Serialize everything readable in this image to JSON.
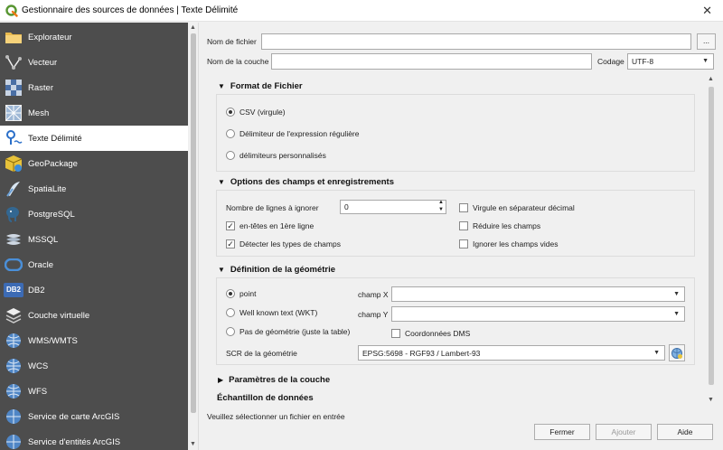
{
  "window": {
    "title": "Gestionnaire des sources de données | Texte Délimité",
    "close_glyph": "✕"
  },
  "sidebar": {
    "items": [
      {
        "label": "Explorateur",
        "icon": "folder-icon"
      },
      {
        "label": "Vecteur",
        "icon": "vector-icon"
      },
      {
        "label": "Raster",
        "icon": "raster-icon"
      },
      {
        "label": "Mesh",
        "icon": "mesh-icon"
      },
      {
        "label": "Texte Délimité",
        "icon": "delimited-text-icon"
      },
      {
        "label": "GeoPackage",
        "icon": "geopackage-icon"
      },
      {
        "label": "SpatiaLite",
        "icon": "spatialite-icon"
      },
      {
        "label": "PostgreSQL",
        "icon": "postgresql-icon"
      },
      {
        "label": "MSSQL",
        "icon": "mssql-icon"
      },
      {
        "label": "Oracle",
        "icon": "oracle-icon"
      },
      {
        "label": "DB2",
        "icon": "db2-icon"
      },
      {
        "label": "Couche virtuelle",
        "icon": "virtual-layer-icon"
      },
      {
        "label": "WMS/WMTS",
        "icon": "wms-icon"
      },
      {
        "label": "WCS",
        "icon": "wcs-icon"
      },
      {
        "label": "WFS",
        "icon": "wfs-icon"
      },
      {
        "label": "Service de carte ArcGIS",
        "icon": "arcgis-map-icon"
      },
      {
        "label": "Service d'entités ArcGIS",
        "icon": "arcgis-feature-icon"
      }
    ],
    "active_index": 4,
    "db2_badge": "DB2"
  },
  "form": {
    "filename_label": "Nom de fichier",
    "filename_value": "",
    "browse_label": "...",
    "layername_label": "Nom de la couche",
    "layername_value": "",
    "encoding_label": "Codage",
    "encoding_value": "UTF-8"
  },
  "file_format": {
    "title": "Format de Fichier",
    "options": [
      "CSV (virgule)",
      "Délimiteur de l'expression régulière",
      "délimiteurs personnalisés"
    ],
    "selected": 0
  },
  "fields_options": {
    "title": "Options des champs et enregistrements",
    "skip_lines_label": "Nombre de lignes à ignorer",
    "skip_lines_value": "0",
    "header_label": "en-têtes en 1ère ligne",
    "header_checked": true,
    "detect_types_label": "Détecter les types de champs",
    "detect_types_checked": true,
    "decimal_comma_label": "Virgule en séparateur décimal",
    "trim_label": "Réduire les champs",
    "discard_empty_label": "Ignorer les champs vides"
  },
  "geometry": {
    "title": "Définition de la géométrie",
    "options": [
      "point",
      "Well known text (WKT)",
      "Pas de géométrie (juste la table)"
    ],
    "selected": 0,
    "x_field_label": "champ X",
    "y_field_label": "champ Y",
    "dms_label": "Coordonnées DMS",
    "crs_label": "SCR de la géométrie",
    "crs_value": "EPSG:5698 - RGF93 / Lambert-93"
  },
  "layer_settings": {
    "title": "Paramètres de la couche"
  },
  "sample_data": {
    "title": "Échantillon de données"
  },
  "status": "Veuillez sélectionner un fichier en entrée",
  "buttons": {
    "close": "Fermer",
    "add": "Ajouter",
    "help": "Aide"
  },
  "glyphs": {
    "check": "✓",
    "tri_down": "▼",
    "tri_right": "▶",
    "arrow_down": "▼",
    "spin_up": "▲",
    "spin_down": "▼"
  },
  "colors": {
    "sidebar_bg": "#4d4d4d",
    "accent": "#589632"
  }
}
